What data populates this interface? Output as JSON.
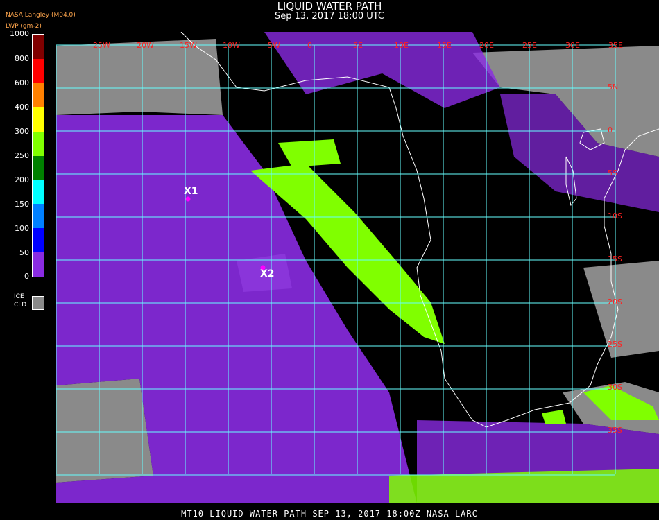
{
  "title": "LIQUID WATER PATH",
  "subtitle": "Sep 13, 2017 18:00 UTC",
  "source_label": "NASA Langley (M04.0)",
  "units_label": "LWP (gm-2)",
  "legend": {
    "ticks": [
      "1000",
      "800",
      "600",
      "400",
      "300",
      "250",
      "200",
      "150",
      "100",
      "50",
      "0"
    ],
    "colors": [
      "#ff0000",
      "#ff8000",
      "#ffff00",
      "#80ff00",
      "#008000",
      "#00ffff",
      "#0080ff",
      "#0000ff",
      "#8a2be2"
    ],
    "ice_label_1": "ICE",
    "ice_label_2": "CLD",
    "ice_color": "#8a8a8a"
  },
  "map": {
    "lon_labels": [
      "25W",
      "20W",
      "15W",
      "10W",
      "5W",
      "0",
      "5E",
      "10E",
      "15E",
      "20E",
      "25E",
      "30E",
      "35E"
    ],
    "lat_labels": [
      "5N",
      "0",
      "5S",
      "10S",
      "15S",
      "20S",
      "25S",
      "30S",
      "35S"
    ],
    "markers": [
      {
        "label": "X1"
      },
      {
        "label": "X2"
      }
    ],
    "grid_color": "#6ff",
    "label_color": "#ff2020"
  },
  "footer": "MT10  LIQUID WATER PATH   SEP 13, 2017 18:00Z   NASA LARC"
}
